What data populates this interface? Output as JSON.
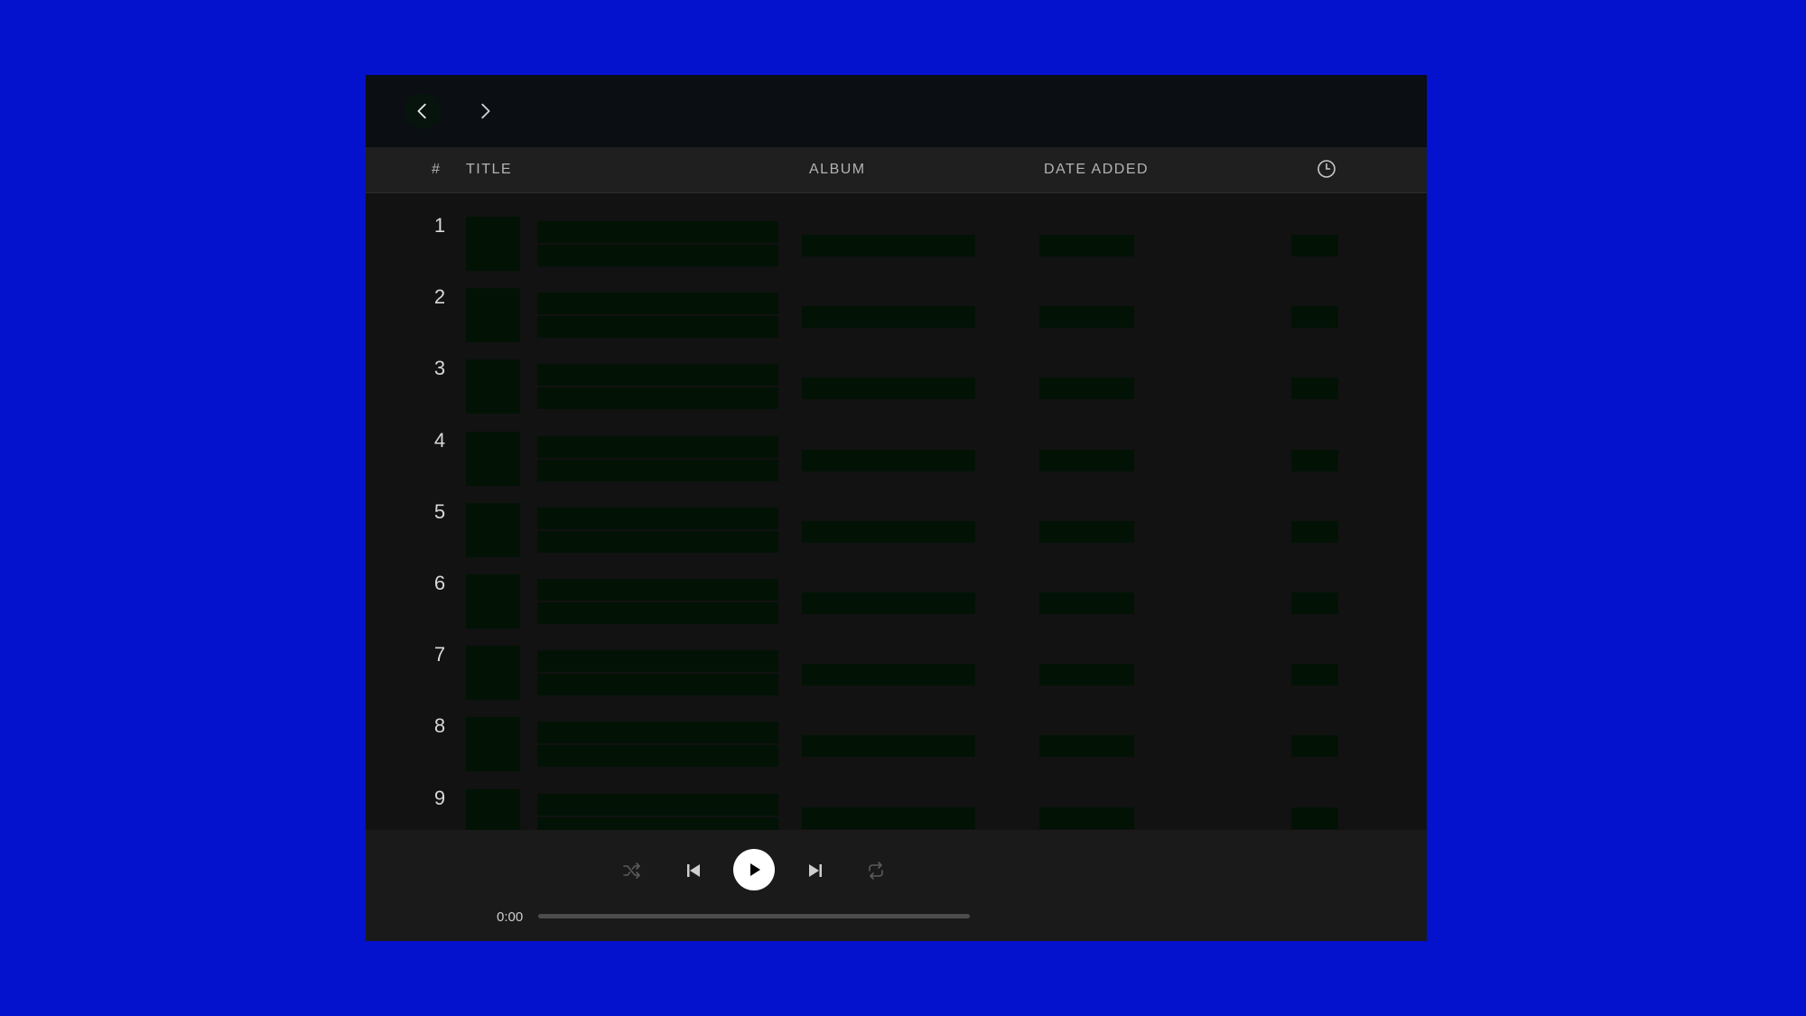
{
  "header": {
    "num": "#",
    "title": "TITLE",
    "album": "ALBUM",
    "date_added": "DATE ADDED",
    "duration_icon": "clock-icon"
  },
  "nav": {
    "back_icon": "chevron-left-icon",
    "forward_icon": "chevron-right-icon"
  },
  "tracks": [
    {
      "num": "1"
    },
    {
      "num": "2"
    },
    {
      "num": "3"
    },
    {
      "num": "4"
    },
    {
      "num": "5"
    },
    {
      "num": "6"
    },
    {
      "num": "7"
    },
    {
      "num": "8"
    },
    {
      "num": "9"
    }
  ],
  "player": {
    "current_time": "0:00",
    "progress": 0.0,
    "controls": [
      "shuffle-icon",
      "previous-icon",
      "play-icon",
      "next-icon",
      "repeat-icon"
    ]
  },
  "colors": {
    "background": "#0411cd",
    "window": "#121212",
    "placeholder": "#021305"
  }
}
